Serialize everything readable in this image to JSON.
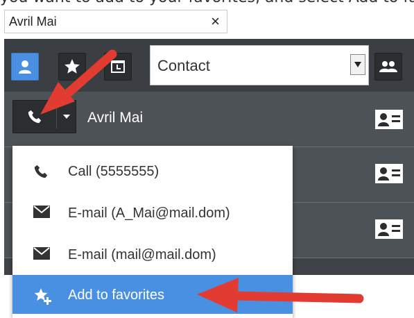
{
  "caption": "you want to add to your favorites, and select Add to favorites.",
  "search": {
    "value": "Avril Mai",
    "clear_glyph": "×"
  },
  "toolbar": {
    "buttons": [
      {
        "icon": "person-icon",
        "active": true
      },
      {
        "icon": "star-icon",
        "active": false
      },
      {
        "icon": "calendar-icon",
        "active": false
      }
    ],
    "filter_value": "Contact",
    "group_icon": "group-icon"
  },
  "contacts": [
    {
      "name": "Avril Mai",
      "icon": "contact-card-icon"
    },
    {
      "name": "",
      "icon": "contact-card-icon"
    },
    {
      "name": "",
      "icon": "contact-card-icon"
    }
  ],
  "menu": {
    "items": [
      {
        "label": "Call (5555555)",
        "icon": "phone-icon"
      },
      {
        "label": "E-mail (A_Mai@mail.dom)",
        "icon": "envelope-icon"
      },
      {
        "label": "E-mail (mail@mail.dom)",
        "icon": "envelope-icon"
      },
      {
        "label": "Add to favorites",
        "icon": "star-plus-icon",
        "highlighted": true
      }
    ]
  },
  "colors": {
    "accent": "#4a90e2",
    "panel": "#4d5257",
    "toolbar": "#3b3f43",
    "annotation_arrow": "#e23c32"
  }
}
